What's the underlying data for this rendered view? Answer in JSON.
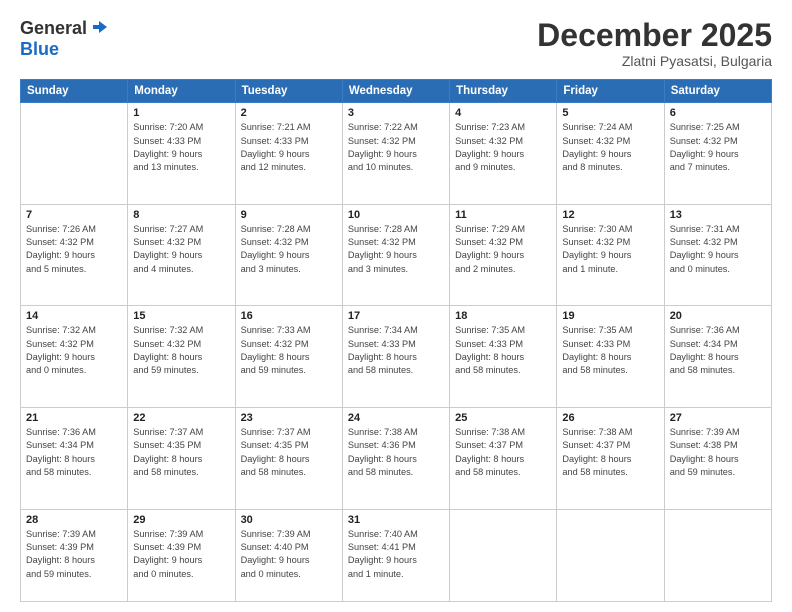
{
  "logo": {
    "general": "General",
    "blue": "Blue"
  },
  "title": "December 2025",
  "location": "Zlatni Pyasatsi, Bulgaria",
  "weekdays": [
    "Sunday",
    "Monday",
    "Tuesday",
    "Wednesday",
    "Thursday",
    "Friday",
    "Saturday"
  ],
  "weeks": [
    [
      {
        "day": "",
        "sunrise": "",
        "sunset": "",
        "daylight": ""
      },
      {
        "day": "1",
        "sunrise": "Sunrise: 7:20 AM",
        "sunset": "Sunset: 4:33 PM",
        "daylight": "Daylight: 9 hours and 13 minutes."
      },
      {
        "day": "2",
        "sunrise": "Sunrise: 7:21 AM",
        "sunset": "Sunset: 4:33 PM",
        "daylight": "Daylight: 9 hours and 12 minutes."
      },
      {
        "day": "3",
        "sunrise": "Sunrise: 7:22 AM",
        "sunset": "Sunset: 4:32 PM",
        "daylight": "Daylight: 9 hours and 10 minutes."
      },
      {
        "day": "4",
        "sunrise": "Sunrise: 7:23 AM",
        "sunset": "Sunset: 4:32 PM",
        "daylight": "Daylight: 9 hours and 9 minutes."
      },
      {
        "day": "5",
        "sunrise": "Sunrise: 7:24 AM",
        "sunset": "Sunset: 4:32 PM",
        "daylight": "Daylight: 9 hours and 8 minutes."
      },
      {
        "day": "6",
        "sunrise": "Sunrise: 7:25 AM",
        "sunset": "Sunset: 4:32 PM",
        "daylight": "Daylight: 9 hours and 7 minutes."
      }
    ],
    [
      {
        "day": "7",
        "sunrise": "Sunrise: 7:26 AM",
        "sunset": "Sunset: 4:32 PM",
        "daylight": "Daylight: 9 hours and 5 minutes."
      },
      {
        "day": "8",
        "sunrise": "Sunrise: 7:27 AM",
        "sunset": "Sunset: 4:32 PM",
        "daylight": "Daylight: 9 hours and 4 minutes."
      },
      {
        "day": "9",
        "sunrise": "Sunrise: 7:28 AM",
        "sunset": "Sunset: 4:32 PM",
        "daylight": "Daylight: 9 hours and 3 minutes."
      },
      {
        "day": "10",
        "sunrise": "Sunrise: 7:28 AM",
        "sunset": "Sunset: 4:32 PM",
        "daylight": "Daylight: 9 hours and 3 minutes."
      },
      {
        "day": "11",
        "sunrise": "Sunrise: 7:29 AM",
        "sunset": "Sunset: 4:32 PM",
        "daylight": "Daylight: 9 hours and 2 minutes."
      },
      {
        "day": "12",
        "sunrise": "Sunrise: 7:30 AM",
        "sunset": "Sunset: 4:32 PM",
        "daylight": "Daylight: 9 hours and 1 minute."
      },
      {
        "day": "13",
        "sunrise": "Sunrise: 7:31 AM",
        "sunset": "Sunset: 4:32 PM",
        "daylight": "Daylight: 9 hours and 0 minutes."
      }
    ],
    [
      {
        "day": "14",
        "sunrise": "Sunrise: 7:32 AM",
        "sunset": "Sunset: 4:32 PM",
        "daylight": "Daylight: 9 hours and 0 minutes."
      },
      {
        "day": "15",
        "sunrise": "Sunrise: 7:32 AM",
        "sunset": "Sunset: 4:32 PM",
        "daylight": "Daylight: 8 hours and 59 minutes."
      },
      {
        "day": "16",
        "sunrise": "Sunrise: 7:33 AM",
        "sunset": "Sunset: 4:32 PM",
        "daylight": "Daylight: 8 hours and 59 minutes."
      },
      {
        "day": "17",
        "sunrise": "Sunrise: 7:34 AM",
        "sunset": "Sunset: 4:33 PM",
        "daylight": "Daylight: 8 hours and 58 minutes."
      },
      {
        "day": "18",
        "sunrise": "Sunrise: 7:35 AM",
        "sunset": "Sunset: 4:33 PM",
        "daylight": "Daylight: 8 hours and 58 minutes."
      },
      {
        "day": "19",
        "sunrise": "Sunrise: 7:35 AM",
        "sunset": "Sunset: 4:33 PM",
        "daylight": "Daylight: 8 hours and 58 minutes."
      },
      {
        "day": "20",
        "sunrise": "Sunrise: 7:36 AM",
        "sunset": "Sunset: 4:34 PM",
        "daylight": "Daylight: 8 hours and 58 minutes."
      }
    ],
    [
      {
        "day": "21",
        "sunrise": "Sunrise: 7:36 AM",
        "sunset": "Sunset: 4:34 PM",
        "daylight": "Daylight: 8 hours and 58 minutes."
      },
      {
        "day": "22",
        "sunrise": "Sunrise: 7:37 AM",
        "sunset": "Sunset: 4:35 PM",
        "daylight": "Daylight: 8 hours and 58 minutes."
      },
      {
        "day": "23",
        "sunrise": "Sunrise: 7:37 AM",
        "sunset": "Sunset: 4:35 PM",
        "daylight": "Daylight: 8 hours and 58 minutes."
      },
      {
        "day": "24",
        "sunrise": "Sunrise: 7:38 AM",
        "sunset": "Sunset: 4:36 PM",
        "daylight": "Daylight: 8 hours and 58 minutes."
      },
      {
        "day": "25",
        "sunrise": "Sunrise: 7:38 AM",
        "sunset": "Sunset: 4:37 PM",
        "daylight": "Daylight: 8 hours and 58 minutes."
      },
      {
        "day": "26",
        "sunrise": "Sunrise: 7:38 AM",
        "sunset": "Sunset: 4:37 PM",
        "daylight": "Daylight: 8 hours and 58 minutes."
      },
      {
        "day": "27",
        "sunrise": "Sunrise: 7:39 AM",
        "sunset": "Sunset: 4:38 PM",
        "daylight": "Daylight: 8 hours and 59 minutes."
      }
    ],
    [
      {
        "day": "28",
        "sunrise": "Sunrise: 7:39 AM",
        "sunset": "Sunset: 4:39 PM",
        "daylight": "Daylight: 8 hours and 59 minutes."
      },
      {
        "day": "29",
        "sunrise": "Sunrise: 7:39 AM",
        "sunset": "Sunset: 4:39 PM",
        "daylight": "Daylight: 9 hours and 0 minutes."
      },
      {
        "day": "30",
        "sunrise": "Sunrise: 7:39 AM",
        "sunset": "Sunset: 4:40 PM",
        "daylight": "Daylight: 9 hours and 0 minutes."
      },
      {
        "day": "31",
        "sunrise": "Sunrise: 7:40 AM",
        "sunset": "Sunset: 4:41 PM",
        "daylight": "Daylight: 9 hours and 1 minute."
      },
      {
        "day": "",
        "sunrise": "",
        "sunset": "",
        "daylight": ""
      },
      {
        "day": "",
        "sunrise": "",
        "sunset": "",
        "daylight": ""
      },
      {
        "day": "",
        "sunrise": "",
        "sunset": "",
        "daylight": ""
      }
    ]
  ]
}
